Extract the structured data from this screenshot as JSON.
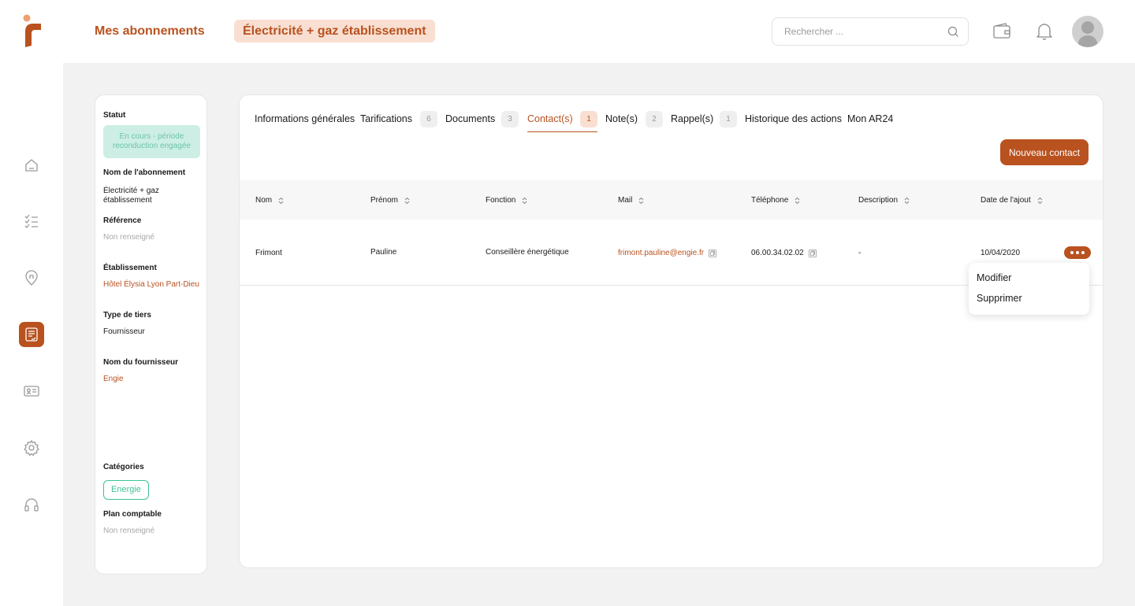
{
  "header": {
    "title": "Mes abonnements",
    "breadcrumb_chip": "Électricité + gaz établissement",
    "search_placeholder": "Rechercher ..."
  },
  "sidebar": {
    "items": [
      {
        "name": "home",
        "icon": "home-icon",
        "active": false
      },
      {
        "name": "tasks",
        "icon": "checklist-icon",
        "active": false
      },
      {
        "name": "locations",
        "icon": "map-pin-icon",
        "active": false
      },
      {
        "name": "subscriptions",
        "icon": "document-icon",
        "active": true
      },
      {
        "name": "contacts",
        "icon": "id-card-icon",
        "active": false
      },
      {
        "name": "settings",
        "icon": "gear-icon",
        "active": false
      },
      {
        "name": "support",
        "icon": "headset-icon",
        "active": false
      }
    ]
  },
  "info": {
    "statut_label": "Statut",
    "statut_value": "En cours - période reconduction engagée",
    "nom_label": "Nom de l'abonnement",
    "nom_value": "Électricité + gaz établissement",
    "reference_label": "Référence",
    "reference_value": "Non renseigné",
    "etablissement_label": "Établissement",
    "etablissement_value": "Hôtel Élysia Lyon Part-Dieu",
    "type_label": "Type de tiers",
    "type_value": "Fournisseur",
    "fournisseur_label": "Nom du fournisseur",
    "fournisseur_value": "Engie",
    "categories_label": "Catégories",
    "categorie_chip": "Energie",
    "plan_label": "Plan comptable",
    "plan_value": "Non renseigné"
  },
  "tabs": [
    {
      "label": "Informations générales",
      "count": null
    },
    {
      "label": "Tarifications",
      "count": "6"
    },
    {
      "label": "Documents",
      "count": "3"
    },
    {
      "label": "Contact(s)",
      "count": "1",
      "active": true
    },
    {
      "label": "Note(s)",
      "count": "2"
    },
    {
      "label": "Rappel(s)",
      "count": "1"
    },
    {
      "label": "Historique des actions",
      "count": null
    },
    {
      "label": "Mon AR24",
      "count": null
    }
  ],
  "new_contact_label": "Nouveau contact",
  "table": {
    "columns": [
      "Nom",
      "Prénom",
      "Fonction",
      "Mail",
      "Téléphone",
      "Description",
      "Date de l'ajout"
    ],
    "rows": [
      {
        "nom": "Frimont",
        "prenom": "Pauline",
        "fonction": "Conseillère énergétique",
        "mail": "frimont.pauline@engie.fr",
        "telephone": "06.00.34.02.02",
        "description": "-",
        "date": "10/04/2020"
      }
    ]
  },
  "row_menu": {
    "items": [
      "Modifier",
      "Supprimer"
    ]
  },
  "colors": {
    "accent": "#b9521f",
    "accent_light": "#f8dfd2",
    "status_bg": "#cdeee5",
    "status_text": "#6cc4ab",
    "category": "#3cc39a"
  }
}
